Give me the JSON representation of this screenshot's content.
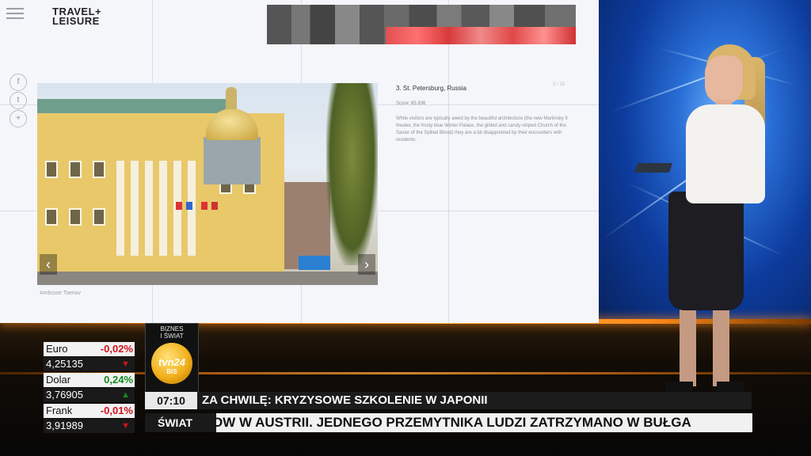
{
  "screen": {
    "logo_line1": "TRAVEL+",
    "logo_line2": "LEISURE",
    "social_icons": [
      "f",
      "t",
      "+"
    ],
    "photo_credit": "Ambrose Tsenov",
    "article": {
      "number_title": "3. St. Petersburg, Russia",
      "score": "Score: 85.936",
      "body": "While visitors are typically awed by the beautiful architecture (the new Mariinsky II theater, the frosty blue Winter Palace, the gilded and candy-striped Church of the Savior of the Spilled Blood) they are a bit disappointed by their encounters with residents.",
      "counter": "3 / 15"
    }
  },
  "ticker": {
    "currencies": [
      {
        "name": "Euro",
        "change": "-0,02%",
        "value": "4,25135",
        "direction": "down"
      },
      {
        "name": "Dolar",
        "change": "0,24%",
        "value": "3,76905",
        "direction": "up"
      },
      {
        "name": "Frank",
        "change": "-0,01%",
        "value": "3,91989",
        "direction": "down"
      }
    ],
    "badge": "BIZNES\nI ŚWIAT",
    "channel_logo": "tvn24",
    "channel_sub": "BiS",
    "time": "07:10",
    "headline": "ZA CHWILĘ: KRYZYSOWE SZKOLENIE W JAPONII",
    "category": "ŚWIAT",
    "crawl": "OW W AUSTRII. JEDNEGO PRZEMYTNIKA LUDZI ZATRZYMANO W BUŁGA"
  },
  "colors": {
    "negative": "#d0121b",
    "positive": "#138a1e",
    "accent_orange": "#ff8a1a"
  }
}
